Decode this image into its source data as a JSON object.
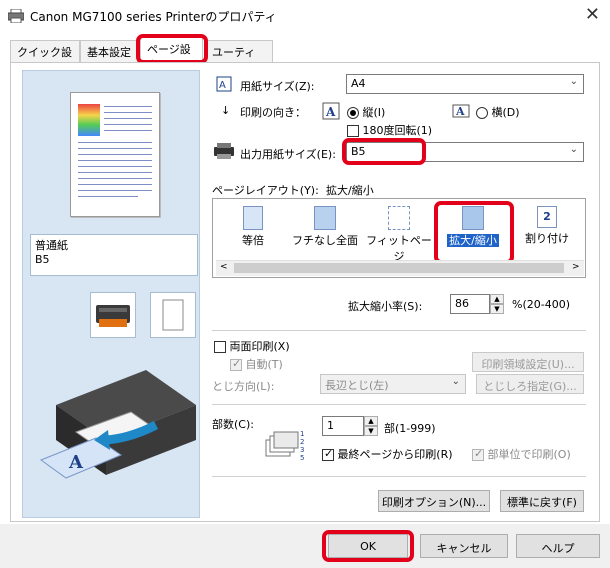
{
  "window": {
    "title": "Canon MG7100 series Printerのプロパティ"
  },
  "tabs": [
    "クイック設定",
    "基本設定",
    "ページ設定",
    "ユーティリティ"
  ],
  "preview": {
    "media_type": "普通紙",
    "paper_size": "B5"
  },
  "settings": {
    "paper_size_label": "用紙サイズ(Z):",
    "paper_size_value": "A4",
    "orientation_label": "印刷の向き：",
    "portrait_label": "縦(I)",
    "landscape_label": "横(D)",
    "rotate_label": "180度回転(1)",
    "output_size_label": "出力用紙サイズ(E):",
    "output_size_value": "B5",
    "layout_label": "ページレイアウト(Y):",
    "layout_value": "拡大/縮小",
    "layout_items": [
      "等倍",
      "フチなし全面",
      "フィットページ",
      "拡大/縮小",
      "割り付け"
    ],
    "scale_label": "拡大縮小率(S):",
    "scale_value": "86",
    "scale_range": "%(20-400)",
    "duplex_label": "両面印刷(X)",
    "auto_label": "自動(T)",
    "print_area_button": "印刷領域設定(U)...",
    "binding_label": "とじ方向(L):",
    "binding_value": "長辺とじ(左)",
    "margin_button": "とじしろ指定(G)...",
    "copies_label": "部数(C):",
    "copies_value": "1",
    "copies_range": "部(1-999)",
    "last_page_label": "最終ページから印刷(R)",
    "collate_label": "部単位で印刷(O)",
    "print_options_button": "印刷オプション(N)...",
    "defaults_button": "標準に戻す(F)"
  },
  "footer": {
    "ok": "OK",
    "cancel": "キャンセル",
    "help": "ヘルプ"
  },
  "colors": {
    "highlight": "#e3001b",
    "preview_bg": "#d8e6f4",
    "selected_item": "#1e63c8"
  }
}
